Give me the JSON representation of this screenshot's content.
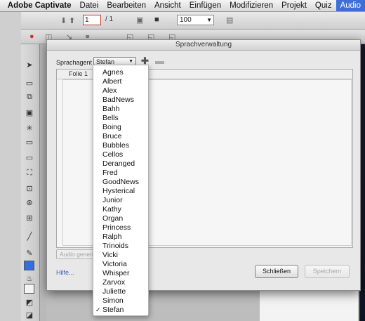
{
  "menubar": {
    "app_name": "Adobe Captivate",
    "items": [
      "Datei",
      "Bearbeiten",
      "Ansicht",
      "Einfügen",
      "Modifizieren",
      "Projekt",
      "Quiz",
      "Audio"
    ],
    "active_item": "Audio"
  },
  "toolbar": {
    "slide_number": "1",
    "slide_total": "/ 1",
    "zoom_value": "100"
  },
  "dialog": {
    "title": "Sprachverwaltung",
    "agent_label": "Sprachagent",
    "agent_selected": "Stefan",
    "table_column": "Folie 1",
    "audio_generate_label": "Audio generieren",
    "help_link": "Hilfe...",
    "close_button": "Schließen",
    "save_button": "Speichern"
  },
  "dropdown": {
    "options": [
      "Agnes",
      "Albert",
      "Alex",
      "BadNews",
      "Bahh",
      "Bells",
      "Boing",
      "Bruce",
      "Bubbles",
      "Cellos",
      "Deranged",
      "Fred",
      "GoodNews",
      "Hysterical",
      "Junior",
      "Kathy",
      "Organ",
      "Princess",
      "Ralph",
      "Trinoids",
      "Vicki",
      "Victoria",
      "Whisper",
      "Zarvox",
      "Juliette",
      "Simon",
      "Stefan"
    ],
    "checked": "Stefan",
    "check_mark": "✓"
  },
  "colors": {
    "menubar_active": "#3d6fd6",
    "fill_color_swatch": "#2f6fe0",
    "help_link": "#3b65b8"
  }
}
